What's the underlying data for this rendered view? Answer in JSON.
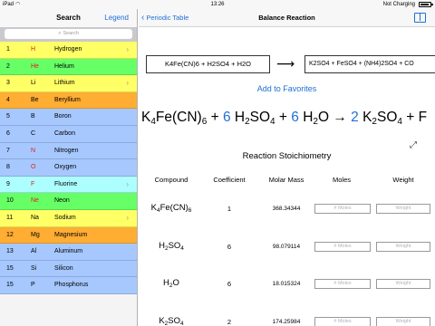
{
  "status_bar": {
    "carrier": "iPad",
    "wifi_icon": "wifi-icon",
    "time": "13:26",
    "charging": "Not Charging",
    "battery_level": 0.9
  },
  "sidebar": {
    "title": "Search",
    "legend_label": "Legend",
    "search_placeholder": "Search",
    "elements": [
      {
        "num": "1",
        "sym": "H",
        "name": "Hydrogen",
        "color": "#ffff66",
        "sym_color": "#e02020",
        "chevron": true
      },
      {
        "num": "2",
        "sym": "He",
        "name": "Helium",
        "color": "#66ff66",
        "sym_color": "#e02020",
        "chevron": false
      },
      {
        "num": "3",
        "sym": "Li",
        "name": "Lithium",
        "color": "#ffff66",
        "sym_color": "#000000",
        "chevron": true
      },
      {
        "num": "4",
        "sym": "Be",
        "name": "Beryllium",
        "color": "#ffad33",
        "sym_color": "#000000",
        "chevron": false
      },
      {
        "num": "5",
        "sym": "B",
        "name": "Boron",
        "color": "#a6c8ff",
        "sym_color": "#000000",
        "chevron": false
      },
      {
        "num": "6",
        "sym": "C",
        "name": "Carbon",
        "color": "#a6c8ff",
        "sym_color": "#000000",
        "chevron": false
      },
      {
        "num": "7",
        "sym": "N",
        "name": "Nitrogen",
        "color": "#a6c8ff",
        "sym_color": "#e02020",
        "chevron": false
      },
      {
        "num": "8",
        "sym": "O",
        "name": "Oxygen",
        "color": "#a6c8ff",
        "sym_color": "#e02020",
        "chevron": false
      },
      {
        "num": "9",
        "sym": "F",
        "name": "Fluorine",
        "color": "#adffff",
        "sym_color": "#e02020",
        "chevron": true
      },
      {
        "num": "10",
        "sym": "Ne",
        "name": "Neon",
        "color": "#66ff66",
        "sym_color": "#e02020",
        "chevron": false
      },
      {
        "num": "11",
        "sym": "Na",
        "name": "Sodium",
        "color": "#ffff66",
        "sym_color": "#000000",
        "chevron": true
      },
      {
        "num": "12",
        "sym": "Mg",
        "name": "Magnesium",
        "color": "#ffad33",
        "sym_color": "#000000",
        "chevron": false
      },
      {
        "num": "13",
        "sym": "Al",
        "name": "Aluminum",
        "color": "#a6c8ff",
        "sym_color": "#000000",
        "chevron": false
      },
      {
        "num": "15",
        "sym": "Si",
        "name": "Silicon",
        "color": "#a6c8ff",
        "sym_color": "#000000",
        "chevron": false
      },
      {
        "num": "15",
        "sym": "P",
        "name": "Phosphorus",
        "color": "#a6c8ff",
        "sym_color": "#000000",
        "chevron": false
      }
    ]
  },
  "nav": {
    "back_label": "Periodic Table",
    "title": "Balance Reaction",
    "book_icon": "book-icon"
  },
  "reaction": {
    "input": "K4Fe(CN)6 + H2SO4 + H2O",
    "arrow": "⟶",
    "output": "K2SO4 + FeSO4 + (NH4)2SO4 + CO",
    "add_favorites": "Add to Favorites",
    "balanced_parts": [
      {
        "t": "K"
      },
      {
        "s": "4"
      },
      {
        "t": "Fe(CN)"
      },
      {
        "s": "6"
      },
      {
        "t": " + "
      },
      {
        "c": "6"
      },
      {
        "t": " H"
      },
      {
        "s": "2"
      },
      {
        "t": "SO"
      },
      {
        "s": "4"
      },
      {
        "t": " + "
      },
      {
        "c": "6"
      },
      {
        "t": " H"
      },
      {
        "s": "2"
      },
      {
        "t": "O → "
      },
      {
        "c": "2"
      },
      {
        "t": " K"
      },
      {
        "s": "2"
      },
      {
        "t": "SO"
      },
      {
        "s": "4"
      },
      {
        "t": " + F"
      }
    ],
    "expand_icon": "expand-icon"
  },
  "stoichiometry": {
    "title": "Reaction Stoichiometry",
    "columns": [
      "Compound",
      "Coefficient",
      "Molar Mass",
      "Moles",
      "Weight"
    ],
    "moles_placeholder": "# Moles",
    "weight_placeholder": "Weight",
    "rows": [
      {
        "compound": [
          {
            "t": "K"
          },
          {
            "s": "4"
          },
          {
            "t": "Fe(CN)"
          },
          {
            "s": "6"
          }
        ],
        "coefficient": "1",
        "molar_mass": "368.34344"
      },
      {
        "compound": [
          {
            "t": "H"
          },
          {
            "s": "2"
          },
          {
            "t": "SO"
          },
          {
            "s": "4"
          }
        ],
        "coefficient": "6",
        "molar_mass": "98.079114"
      },
      {
        "compound": [
          {
            "t": "H"
          },
          {
            "s": "2"
          },
          {
            "t": "O"
          }
        ],
        "coefficient": "6",
        "molar_mass": "18.015324"
      },
      {
        "compound": [
          {
            "t": "K"
          },
          {
            "s": "2"
          },
          {
            "t": "SO"
          },
          {
            "s": "4"
          }
        ],
        "coefficient": "2",
        "molar_mass": "174.25984"
      }
    ]
  }
}
